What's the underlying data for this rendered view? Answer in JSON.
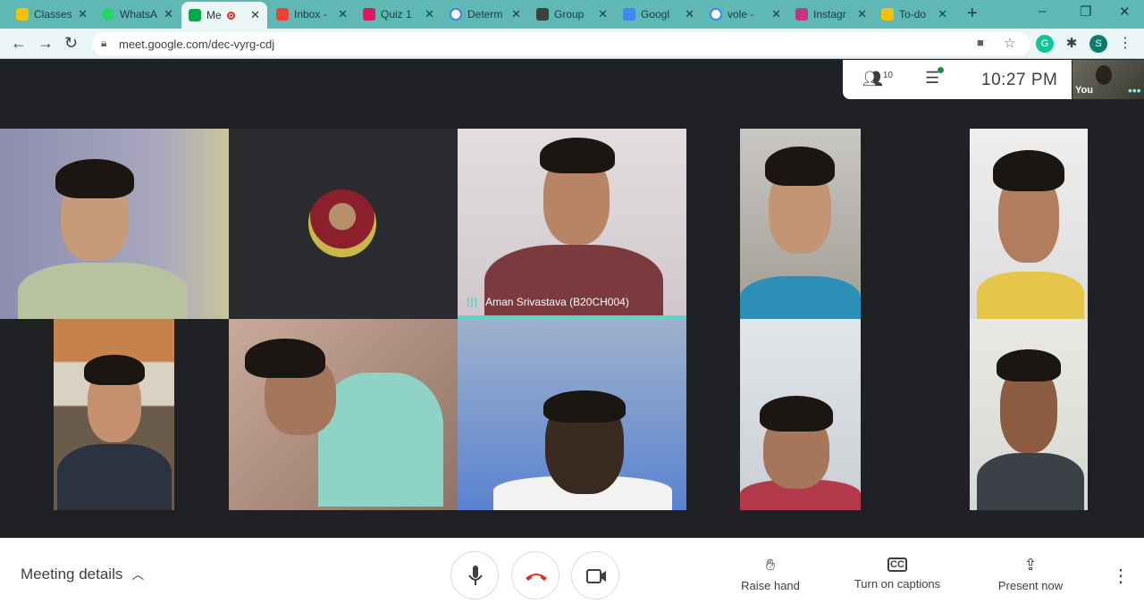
{
  "browser": {
    "tabs": [
      {
        "label": "Classes",
        "favicon_color": "#f4c20d"
      },
      {
        "label": "WhatsA",
        "favicon_color": "#25d366"
      },
      {
        "label": "Me",
        "favicon_color": "#00ac47",
        "active": true
      },
      {
        "label": "Inbox -",
        "favicon_color": "#ea4335"
      },
      {
        "label": "Quiz 1",
        "favicon_color": "#d81b60"
      },
      {
        "label": "Determ",
        "favicon_color": "#4285f4"
      },
      {
        "label": "Group",
        "favicon_color": "#3c4043"
      },
      {
        "label": "Googl",
        "favicon_color": "#4285f4"
      },
      {
        "label": "vole -",
        "favicon_color": "#4285f4"
      },
      {
        "label": "Instagr",
        "favicon_color": "#c13584"
      },
      {
        "label": "To-do",
        "favicon_color": "#f4c20d"
      }
    ],
    "new_tab": "+",
    "window_controls": {
      "minimize": "–",
      "maximize": "❐",
      "close": "✕"
    },
    "address": {
      "url": "meet.google.com/dec-vyrg-cdj"
    },
    "profile_initial": "S",
    "grammarly_initial": "G"
  },
  "meet": {
    "participants_count": "10",
    "time": "10:27 PM",
    "self_label": "You",
    "active_speaker": "Aman Srivastava (B20CH004)",
    "tiles_count": 10
  },
  "bottom_bar": {
    "meeting_details": "Meeting details",
    "raise_hand": "Raise hand",
    "captions": "Turn on captions",
    "present": "Present now"
  },
  "colors": {
    "tabstrip": "#5fb8b4",
    "speaking_accent": "#5ed4c9",
    "hangup": "#d93025"
  }
}
